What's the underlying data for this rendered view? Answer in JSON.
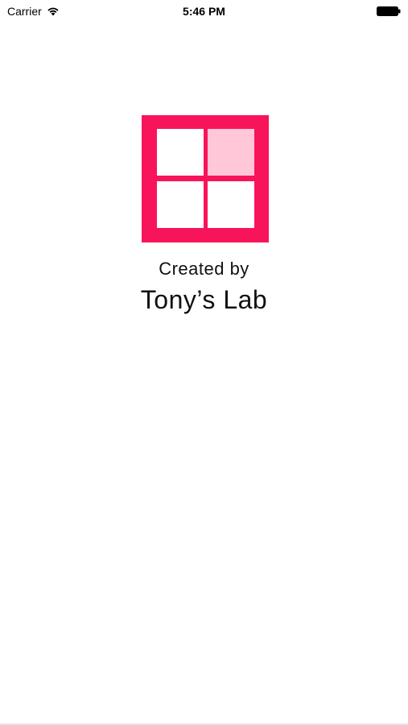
{
  "status_bar": {
    "carrier": "Carrier",
    "time": "5:46 PM",
    "wifi_icon": "wifi-icon",
    "battery_icon": "battery-icon"
  },
  "logo": {
    "icon": "four-pane-window-logo",
    "frame_color": "#F8145A",
    "highlight_color": "#FFC7D8",
    "pane_color": "#FFFFFF"
  },
  "credits": {
    "prefix": "Created by",
    "name": "Tony’s Lab"
  }
}
